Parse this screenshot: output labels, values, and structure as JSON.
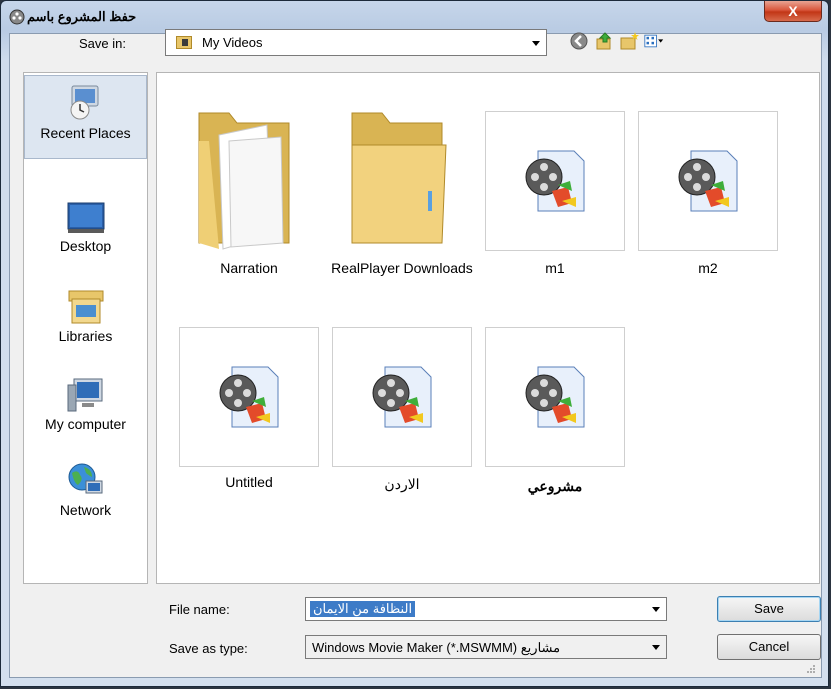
{
  "window": {
    "title": "حفظ المشروع باسم",
    "close_label": "X"
  },
  "toolbar": {
    "save_in_label": "Save in:",
    "save_in_value": "My Videos"
  },
  "places": [
    {
      "label": "Recent Places"
    },
    {
      "label": "Desktop"
    },
    {
      "label": "Libraries"
    },
    {
      "label": "My computer"
    },
    {
      "label": "Network"
    }
  ],
  "files": [
    {
      "name": "Narration",
      "kind": "folder"
    },
    {
      "name": "RealPlayer Downloads",
      "kind": "folder"
    },
    {
      "name": "m1",
      "kind": "movie-project"
    },
    {
      "name": "m2",
      "kind": "movie-project"
    },
    {
      "name": "Untitled",
      "kind": "movie-project"
    },
    {
      "name": "الاردن",
      "kind": "movie-project"
    },
    {
      "name": "مشروعي",
      "kind": "movie-project"
    }
  ],
  "form": {
    "file_name_label": "File name:",
    "file_name_value": "النظافة من الايمان",
    "save_as_type_label": "Save as type:",
    "save_as_type_value": "Windows Movie Maker (*.MSWMM) مشاريع"
  },
  "buttons": {
    "save": "Save",
    "cancel": "Cancel"
  },
  "colors": {
    "selection": "#3d7bc7",
    "folder": "#e8c66a",
    "close": "#c23616"
  }
}
